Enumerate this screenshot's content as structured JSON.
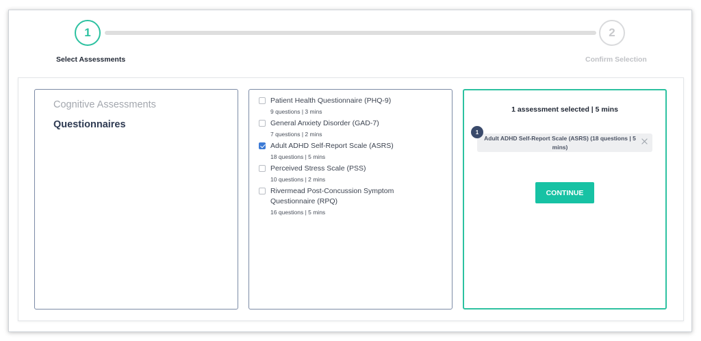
{
  "stepper": {
    "steps": [
      {
        "number": "1",
        "label": "Select Assessments",
        "state": "active"
      },
      {
        "number": "2",
        "label": "Confirm Selection",
        "state": "inactive"
      }
    ]
  },
  "categories": [
    {
      "label": "Cognitive Assessments",
      "selected": false
    },
    {
      "label": "Questionnaires",
      "selected": true
    }
  ],
  "assessments": [
    {
      "name": "Patient Health Questionnaire (PHQ-9)",
      "meta": "9 questions | 3 mins",
      "checked": false
    },
    {
      "name": "General Anxiety Disorder (GAD-7)",
      "meta": "7 questions | 2 mins",
      "checked": false
    },
    {
      "name": "Adult ADHD Self-Report Scale (ASRS)",
      "meta": "18 questions | 5 mins",
      "checked": true
    },
    {
      "name": "Perceived Stress Scale (PSS)",
      "meta": "10 questions | 2 mins",
      "checked": false
    },
    {
      "name": "Rivermead Post-Concussion Symptom Questionnaire (RPQ)",
      "meta": "16 questions | 5 mins",
      "checked": false
    }
  ],
  "summary": {
    "heading": "1 assessment selected | 5 mins",
    "selected": [
      {
        "order": "1",
        "label": "Adult ADHD Self-Report Scale (ASRS) (18 questions | 5 mins)",
        "remove_icon": "close-icon"
      }
    ],
    "continue_label": "CONTINUE"
  },
  "colors": {
    "accent": "#2cc1a0",
    "button": "#17c2a4",
    "panel_border": "#7b8aa5",
    "checkbox_checked": "#3d7bd6",
    "badge": "#3a4a6b"
  }
}
